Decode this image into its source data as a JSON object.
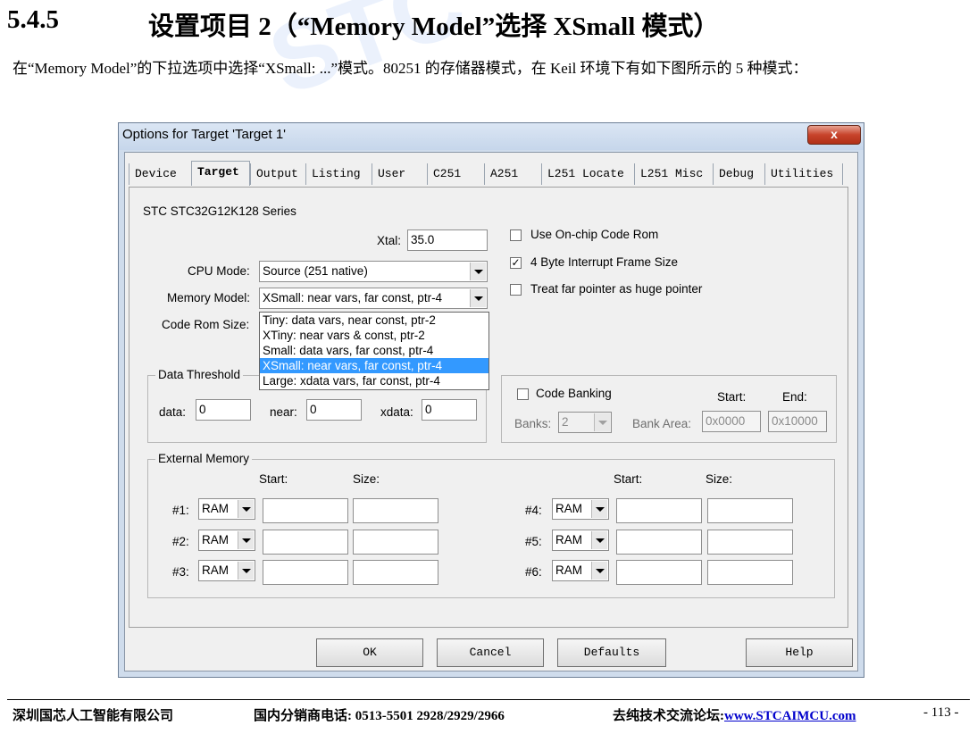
{
  "heading": {
    "number": "5.4.5",
    "title": "设置项目 2（“Memory Model”选择 XSmall 模式）"
  },
  "paragraph": "在“Memory Model”的下拉选项中选择“XSmall: ...”模式。80251 的存储器模式，在 Keil 环境下有如下图所示的 5 种模式：",
  "watermark": "STC",
  "dialog": {
    "title": "Options for Target 'Target 1'",
    "close": "x",
    "tabs": [
      "Device",
      "Target",
      "Output",
      "Listing",
      "User",
      "C251",
      "A251",
      "L251 Locate",
      "L251 Misc",
      "Debug",
      "Utilities"
    ],
    "active_tab": "Target",
    "device_name": "STC STC32G12K128 Series",
    "xtal_label": "Xtal:",
    "xtal_value": "35.0",
    "cpu_mode_label": "CPU Mode:",
    "cpu_mode_value": "Source (251 native)",
    "memory_model_label": "Memory Model:",
    "memory_model_value": "XSmall: near vars, far const, ptr-4",
    "code_rom_size_label": "Code Rom Size:",
    "memory_model_options": [
      "Tiny: data vars, near const, ptr-2",
      "XTiny: near vars & const, ptr-2",
      "Small: data vars, far const, ptr-4",
      "XSmall: near vars, far const, ptr-4",
      "Large: xdata vars, far const, ptr-4"
    ],
    "selected_option_index": 3,
    "use_onchip_code_rom": {
      "label": "Use On-chip Code Rom",
      "checked": false
    },
    "four_byte_interrupt": {
      "label": "4 Byte Interrupt Frame Size",
      "checked": true
    },
    "treat_far_pointer": {
      "label": "Treat far pointer as huge pointer",
      "checked": false
    },
    "data_threshold": {
      "group_label": "Data Threshold",
      "data_label": "data:",
      "data_value": "0",
      "near_label": "near:",
      "near_value": "0",
      "xdata_label": "xdata:",
      "xdata_value": "0"
    },
    "code_banking": {
      "label": "Code Banking",
      "checked": false,
      "banks_label": "Banks:",
      "banks_value": "2",
      "bank_area_label": "Bank Area:",
      "start_label": "Start:",
      "start_value": "0x0000",
      "end_label": "End:",
      "end_value": "0x10000"
    },
    "external_memory": {
      "group_label": "External Memory",
      "start_header": "Start:",
      "size_header": "Size:",
      "rows": [
        {
          "label": "#1:",
          "type": "RAM"
        },
        {
          "label": "#2:",
          "type": "RAM"
        },
        {
          "label": "#3:",
          "type": "RAM"
        },
        {
          "label": "#4:",
          "type": "RAM"
        },
        {
          "label": "#5:",
          "type": "RAM"
        },
        {
          "label": "#6:",
          "type": "RAM"
        }
      ]
    },
    "buttons": {
      "ok": "OK",
      "cancel": "Cancel",
      "defaults": "Defaults",
      "help": "Help"
    }
  },
  "footer": {
    "company": "深圳国芯人工智能有限公司",
    "phone": "国内分销商电话: 0513-5501 2928/2929/2966",
    "forum_label": "去纯技术交流论坛:",
    "forum_link": "www.STCAIMCU.com",
    "page": "- 113 -"
  }
}
